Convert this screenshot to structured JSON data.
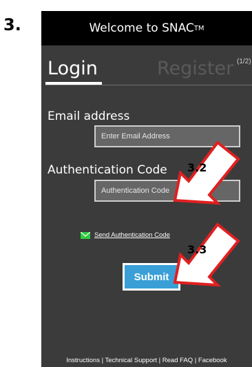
{
  "step_number": "3.",
  "app": {
    "title": "Welcome to SNAC",
    "title_mark": "TM"
  },
  "tabs": {
    "login": "Login",
    "register": "Register",
    "register_step": "(1/2)"
  },
  "form": {
    "email_label": "Email address",
    "email_placeholder": "Enter Email Address",
    "auth_label": "Authentication Code",
    "auth_placeholder": "Authentication Code",
    "send_link": "Send Authentication Code",
    "submit_label": "Submit"
  },
  "footer": {
    "text": "Instructions | Technical Support | Read FAQ | Facebook"
  },
  "callouts": [
    {
      "label": "3.2",
      "icon": "red-arrow-icon"
    },
    {
      "label": "3.3",
      "icon": "red-arrow-icon"
    }
  ],
  "colors": {
    "panel_bg": "#3b3b3b",
    "topbar_bg": "#000000",
    "submit_bg": "#3a9fd6",
    "arrow_red": "#e02020",
    "mail_icon": "#2ecc40"
  }
}
